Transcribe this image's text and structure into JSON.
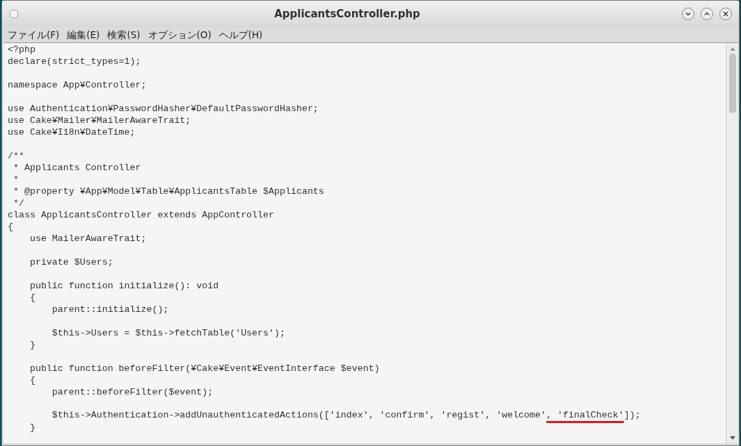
{
  "window": {
    "title": "ApplicantsController.php"
  },
  "menu": [
    {
      "label": "ファイル(F)"
    },
    {
      "label": "編集(E)"
    },
    {
      "label": "検索(S)"
    },
    {
      "label": "オプション(O)"
    },
    {
      "label": "ヘルプ(H)"
    }
  ],
  "editor": {
    "lines": [
      {
        "kind": "code",
        "text": "<?php"
      },
      {
        "kind": "code",
        "text": "declare(strict_types=1);"
      },
      {
        "kind": "blank"
      },
      {
        "kind": "code",
        "text": "namespace App¥Controller;"
      },
      {
        "kind": "blank"
      },
      {
        "kind": "code",
        "text": "use Authentication¥PasswordHasher¥DefaultPasswordHasher;"
      },
      {
        "kind": "code",
        "text": "use Cake¥Mailer¥MailerAwareTrait;"
      },
      {
        "kind": "code",
        "text": "use Cake¥I18n¥DateTime;"
      },
      {
        "kind": "blank"
      },
      {
        "kind": "code",
        "text": "/**"
      },
      {
        "kind": "code",
        "text": " * Applicants Controller"
      },
      {
        "kind": "code",
        "text": " *"
      },
      {
        "kind": "code",
        "text": " * @property ¥App¥Model¥Table¥ApplicantsTable $Applicants"
      },
      {
        "kind": "code",
        "text": " */"
      },
      {
        "kind": "code",
        "text": "class ApplicantsController extends AppController"
      },
      {
        "kind": "code",
        "text": "{"
      },
      {
        "kind": "code",
        "text": "    use MailerAwareTrait;"
      },
      {
        "kind": "blank"
      },
      {
        "kind": "code",
        "text": "    private $Users;"
      },
      {
        "kind": "blank"
      },
      {
        "kind": "code",
        "text": "    public function initialize(): void"
      },
      {
        "kind": "code",
        "text": "    {"
      },
      {
        "kind": "code",
        "text": "        parent::initialize();"
      },
      {
        "kind": "blank"
      },
      {
        "kind": "code",
        "text": "        $this->Users = $this->fetchTable('Users');"
      },
      {
        "kind": "code",
        "text": "    }"
      },
      {
        "kind": "blank"
      },
      {
        "kind": "code",
        "text": "    public function beforeFilter(¥Cake¥Event¥EventInterface $event)"
      },
      {
        "kind": "code",
        "text": "    {"
      },
      {
        "kind": "code",
        "text": "        parent::beforeFilter($event);"
      },
      {
        "kind": "blank"
      },
      {
        "kind": "marked",
        "parts": [
          {
            "text": "        $this->Authentication->addUnauthenticatedActions(['index', 'confirm', 'regist', 'welcome'",
            "underlined": false
          },
          {
            "text": ", 'finalCheck'",
            "underlined": true
          },
          {
            "text": "]);",
            "underlined": false
          }
        ]
      },
      {
        "kind": "code",
        "text": "    }"
      }
    ]
  }
}
